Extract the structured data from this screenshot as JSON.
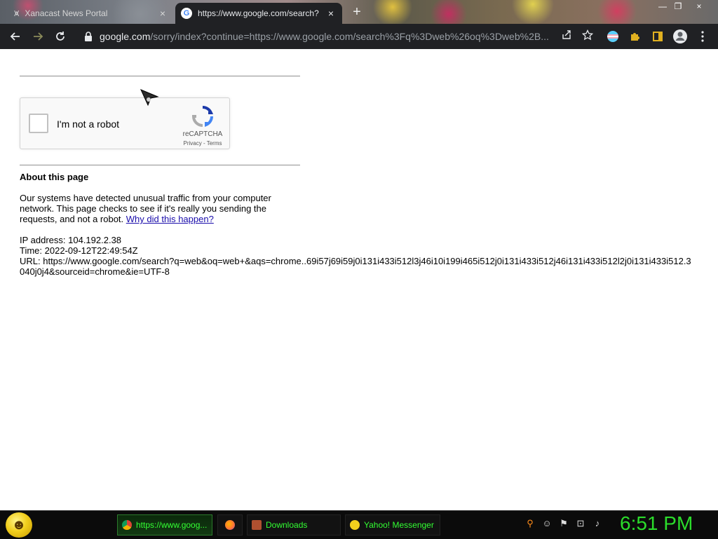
{
  "browser": {
    "tabs": [
      {
        "title": "Xanacast News Portal",
        "active": false,
        "close": "×"
      },
      {
        "title": "https://www.google.com/search?",
        "active": true,
        "close": "×"
      }
    ],
    "new_tab": "+",
    "window_controls": [
      "—",
      "❐",
      "×"
    ],
    "address_host": "google.com",
    "address_path": "/sorry/index?continue=https://www.google.com/search%3Fq%3Dweb%26oq%3Dweb%2B...",
    "icons": [
      "back-icon",
      "forward-icon",
      "reload-icon",
      "lock-icon",
      "share-icon",
      "star-icon",
      "extension-icon",
      "puzzle-icon",
      "sidepanel-icon",
      "profile-icon",
      "menu-icon"
    ]
  },
  "page": {
    "captcha": {
      "label": "I'm not a robot",
      "brand": "reCAPTCHA",
      "links": "Privacy - Terms"
    },
    "about_title": "About this page",
    "paragraph_text": "Our systems have detected unusual traffic from your computer network. This page checks to see if it's really you sending the requests, and not a robot. ",
    "paragraph_link": "Why did this happen?",
    "ip_line": "IP address: 104.192.2.38",
    "time_line": "Time: 2022-09-12T22:49:54Z",
    "url_line": "URL: https://www.google.com/search?q=web&oq=web+&aqs=chrome..69i57j69i59j0i131i433i512l3j46i10i199i465i512j0i131i433i512j46i131i433i512l2j0i131i433i512.3040j0j4&sourceid=chrome&ie=UTF-8"
  },
  "taskbar": {
    "tasks": [
      {
        "label": "https://www.goog...",
        "icon_color": "#4285f4"
      },
      {
        "label": "",
        "icon_color": "#ff7139"
      },
      {
        "label": "Downloads",
        "icon_color": "#b05030"
      },
      {
        "label": "Yahoo! Messenger",
        "icon_color": "#f2cf1d"
      }
    ],
    "tray_icons": [
      "search-icon",
      "smiley-icon",
      "flag-icon",
      "network-icon",
      "volume-icon"
    ],
    "clock": "6:51 PM"
  },
  "colors": {
    "toolbar_bg": "#202124",
    "link": "#1a0dab",
    "clock": "#2bdc2b"
  }
}
